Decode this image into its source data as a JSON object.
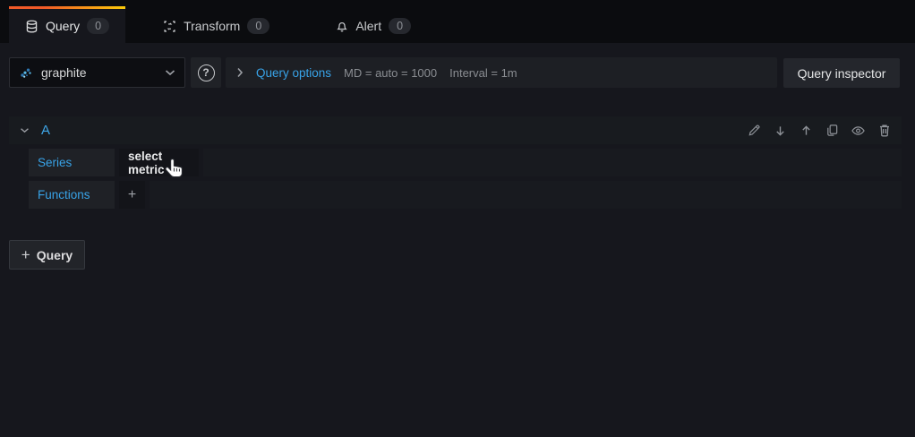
{
  "tabs": [
    {
      "label": "Query",
      "count": "0"
    },
    {
      "label": "Transform",
      "count": "0"
    },
    {
      "label": "Alert",
      "count": "0"
    }
  ],
  "toolbar": {
    "datasource_value": "graphite",
    "help_icon_text": "?",
    "query_options_label": "Query options",
    "max_data_points_text": "MD = auto = 1000",
    "interval_text": "Interval = 1m",
    "query_inspector_label": "Query inspector"
  },
  "query_row": {
    "ref_id": "A",
    "series_label": "Series",
    "select_metric_label": "select metric",
    "functions_label": "Functions",
    "add_function_label": "+",
    "action_icons": [
      "edit",
      "move-down",
      "move-up",
      "duplicate",
      "toggle-visibility",
      "delete"
    ]
  },
  "footer": {
    "add_query_plus": "+",
    "add_query_label": "Query"
  },
  "colors": {
    "accent_blue": "#38a3e8",
    "tab_gradient_start": "#f05a28",
    "tab_gradient_end": "#fbca0a",
    "page_bg": "#16171d",
    "topbar_bg": "#0b0c0f",
    "row_bg": "#181b1f"
  }
}
